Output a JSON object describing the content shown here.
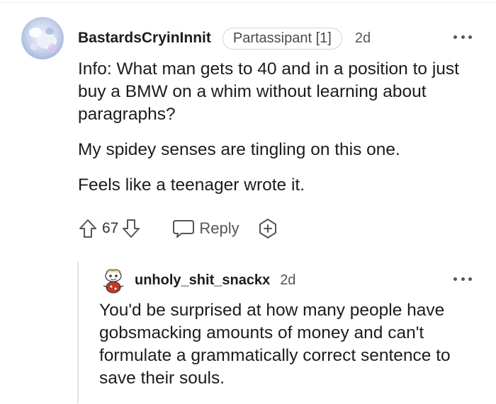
{
  "comment": {
    "username": "BastardsCryinInnit",
    "flair": "Partassipant [1]",
    "time": "2d",
    "paragraphs": [
      "Info: What man gets to 40 and in a position to just buy a BMW on a whim without learning about paragraphs?",
      "My spidey senses are tingling on this one.",
      "Feels like a teenager wrote it."
    ],
    "votes": "67",
    "reply_label": "Reply",
    "icons": {
      "avatar": "snoo-avatar-icon",
      "more": "more-options-icon",
      "upvote": "upvote-arrow-icon",
      "downvote": "downvote-arrow-icon",
      "reply": "speech-bubble-icon",
      "award": "award-plus-icon"
    }
  },
  "reply": {
    "username": "unholy_shit_snackx",
    "time": "2d",
    "text": "You'd be surprised at how many people have gobsmacking amounts of money and can't formulate a grammatically correct sentence to save their souls.",
    "icons": {
      "avatar": "snoo-avatar-icon",
      "more": "more-options-icon"
    }
  },
  "colors": {
    "text": "#1c1c1c",
    "muted": "#555555",
    "border": "#d4d4d4",
    "thread_line": "#e2e2e2"
  }
}
